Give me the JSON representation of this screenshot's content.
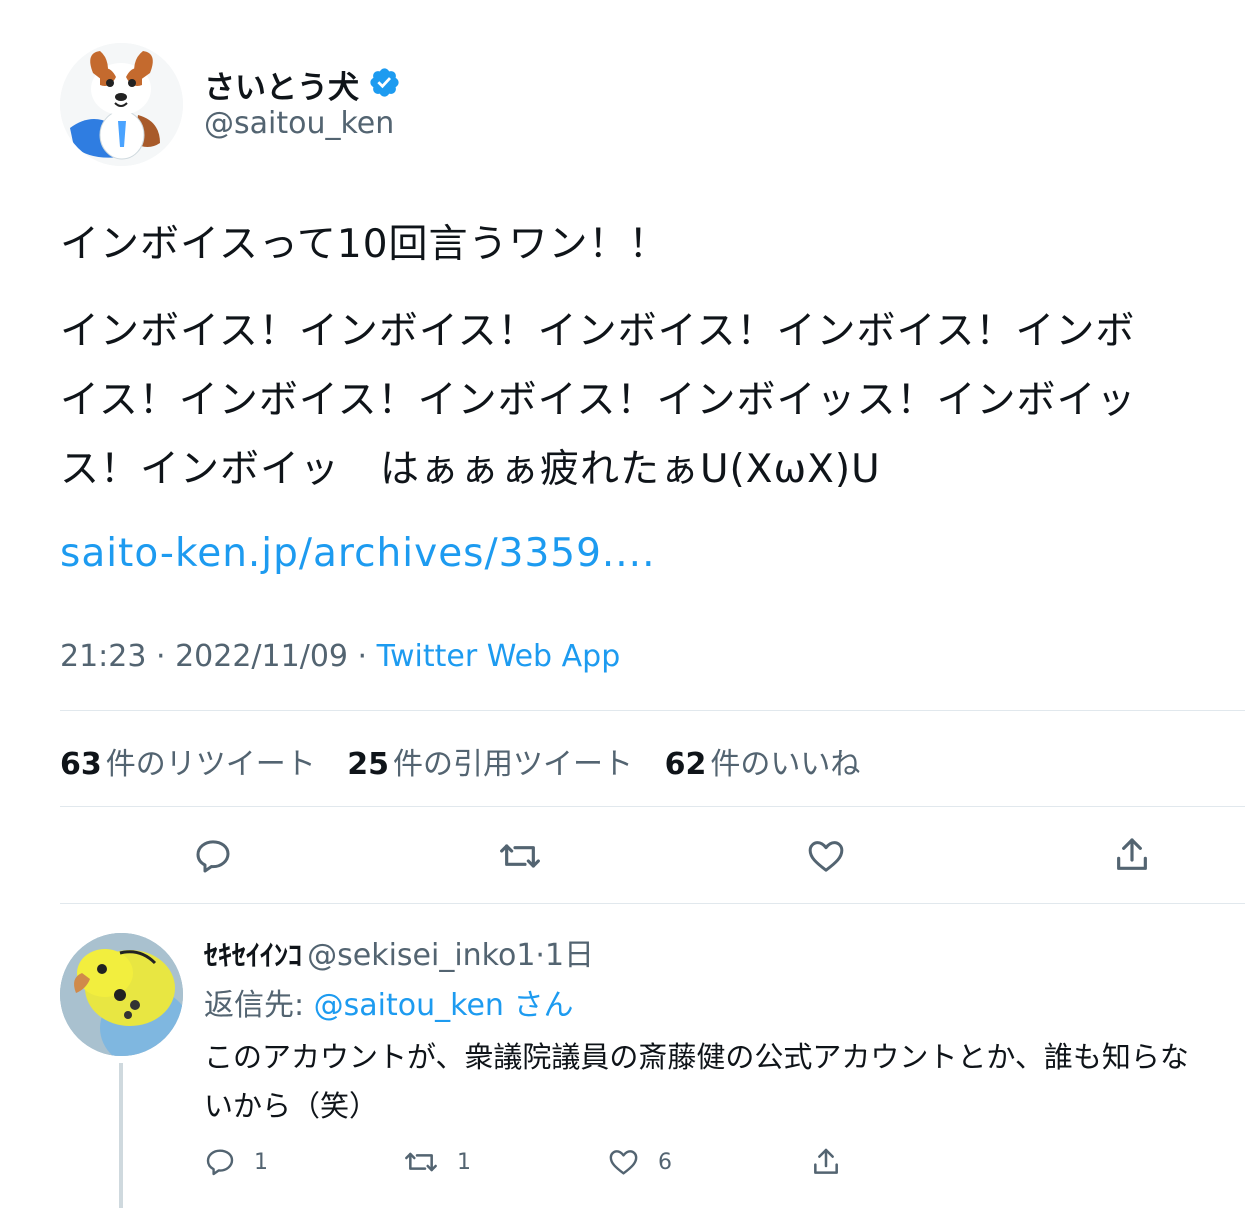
{
  "tweet": {
    "author_name": "さいとう犬",
    "author_handle": "@saitou_ken",
    "verified_icon": "verified-badge-icon",
    "text_line1": "インボイスって10回言うワン！！",
    "text_line2": "インボイス！インボイス！インボイス！インボイス！インボ",
    "text_line3": "イス！インボイス！インボイス！インボイッス！インボイッ",
    "text_line4": "ス！インボイッ　はぁぁぁ疲れたぁU(XωX)U",
    "link": "saito-ken.jp/archives/3359....",
    "time": "21:23",
    "date": "2022/11/09",
    "separator": " · ",
    "source": "Twitter Web App"
  },
  "stats": {
    "retweets_count": "63",
    "retweets_label": "件のリツイート",
    "quotes_count": "25",
    "quotes_label": "件の引用ツイート",
    "likes_count": "62",
    "likes_label": "件のいいね"
  },
  "actions": [
    "reply-icon",
    "retweet-icon",
    "like-icon",
    "share-icon"
  ],
  "reply": {
    "author_name": "ｾｷｾｲｲﾝｺ",
    "author_handle": "@sekisei_inko1",
    "time": "·1日",
    "replying_prefix": "返信先: ",
    "replying_to": "@saitou_ken",
    "replying_suffix": " さん",
    "text_line1": "このアカウントが、衆議院議員の斎藤健の公式アカウントとか、誰も知らな",
    "text_line2": "いから（笑）",
    "reply_count": "1",
    "retweet_count": "1",
    "like_count": "6"
  },
  "colors": {
    "accent": "#1d9bf0",
    "secondary": "#536471",
    "text": "#0f1419",
    "divider": "#e1e8ed"
  }
}
